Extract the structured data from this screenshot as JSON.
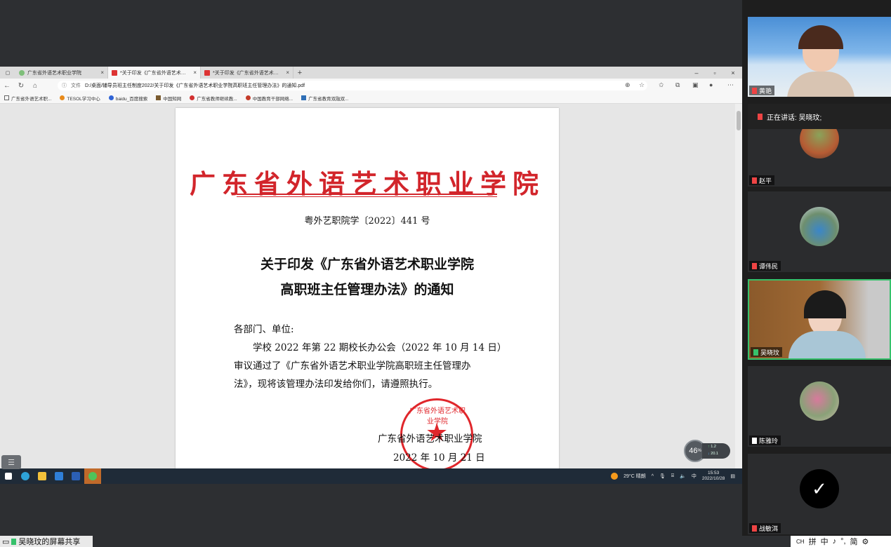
{
  "browser": {
    "tabs": [
      {
        "label": "广东省外语艺术职业学院",
        "close": "×",
        "icon": "green-leaf-icon"
      },
      {
        "label": "*关于印发《广东省外语艺术职业…",
        "close": "×",
        "icon": "pdf-icon"
      },
      {
        "label": "*关于印发《广东省外语艺术职业…",
        "close": "×",
        "icon": "pdf-icon"
      }
    ],
    "new_tab": "+",
    "window_controls": {
      "minimize": "–",
      "restore": "▫",
      "close": "×"
    },
    "address": {
      "info_label": "文件",
      "url": "D:/桌面/辅导员班主任制度2022/关于印发《广东省外语艺术职业学院高职班主任管理办法》的通知.pdf"
    },
    "favorites": [
      {
        "label": "广东省外语艺术职..."
      },
      {
        "label": "TESOL学习中心"
      },
      {
        "label": "baidu_百度搜索"
      },
      {
        "label": "中国知网"
      },
      {
        "label": "广东省教师继续教..."
      },
      {
        "label": "中国教育干部网络..."
      },
      {
        "label": "广东省教育双融双..."
      }
    ]
  },
  "document": {
    "org_title": "广东省外语艺术职业学院",
    "doc_number": "粤外艺职院学〔2022〕441 号",
    "title_line1": "关于印发《广东省外语艺术职业学院",
    "title_line2": "高职班主任管理办法》的通知",
    "salutation": "各部门、单位:",
    "body_line1": "　　学校 2022 年第 22 期校长办公会（2022 年 10 月 14 日）",
    "body_line2": "审议通过了《广东省外语艺术职业学院高职班主任管理办",
    "body_line3": "法》，现将该管理办法印发给你们，请遵照执行。",
    "sign_org": "广东省外语艺术职业学院",
    "sign_date": "2022 年 10 月 21 日",
    "seal_text": "广东省外语艺术职业学院"
  },
  "netbadge": {
    "value": "46",
    "unit": "%",
    "up": "1.2",
    "down": "20.1"
  },
  "taskbar": {
    "weather": "29°C 晴朗",
    "ime": "中",
    "time": "15:53",
    "date": "2022/10/28"
  },
  "meeting": {
    "speaking_label": "正在讲话: 吴晓玟;",
    "participants": [
      {
        "name": "黄艳"
      },
      {
        "name": "赵平"
      },
      {
        "name": "谭伟民"
      },
      {
        "name": "吴晓玟"
      },
      {
        "name": "陈雅玲"
      },
      {
        "name": "战敏洱"
      }
    ],
    "share_label": "吴晓玟的屏幕共享",
    "ime_bar": [
      "CH",
      "拼",
      "中",
      "♪",
      "°,",
      "简",
      "⚙"
    ]
  },
  "colors": {
    "seal_red": "#e0262b",
    "title_red": "#d2252b",
    "active_border": "#36c16b"
  }
}
